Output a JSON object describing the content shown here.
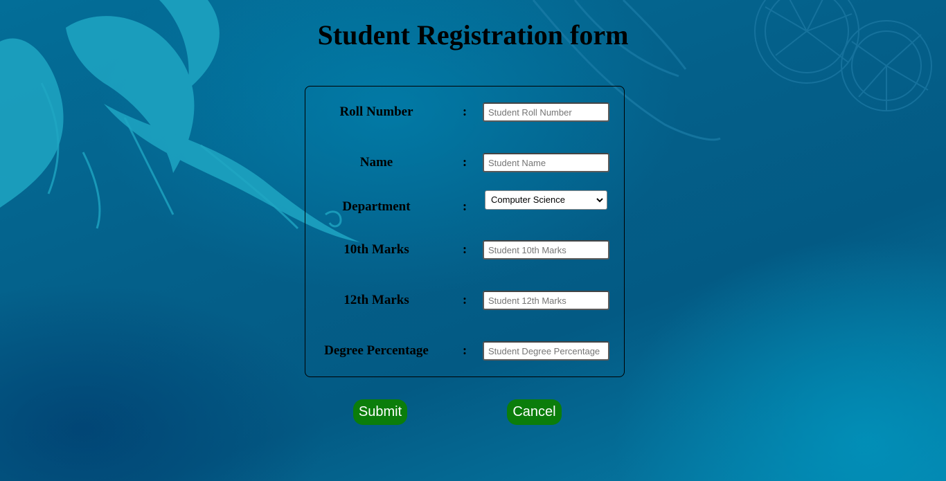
{
  "page": {
    "title": "Student Registration form"
  },
  "form": {
    "fields": [
      {
        "label": "Roll Number",
        "separator": ":",
        "type": "text",
        "value": "",
        "placeholder": "Student Roll Number"
      },
      {
        "label": "Name",
        "separator": ":",
        "type": "text",
        "value": "",
        "placeholder": "Student Name"
      },
      {
        "label": "Department",
        "separator": ":",
        "type": "select",
        "value": "Computer Science"
      },
      {
        "label": "10th Marks",
        "separator": ":",
        "type": "text",
        "value": "",
        "placeholder": "Student 10th Marks"
      },
      {
        "label": "12th Marks",
        "separator": ":",
        "type": "text",
        "value": "",
        "placeholder": "Student 12th Marks"
      },
      {
        "label": "Degree Percentage",
        "separator": ":",
        "type": "text",
        "value": "",
        "placeholder": "Student Degree Percentage"
      }
    ]
  },
  "buttons": {
    "submit_label": "Submit",
    "cancel_label": "Cancel"
  },
  "colors": {
    "button_bg": "#0b7d0b",
    "button_text": "#ffffff",
    "background_primary": "#04608a",
    "background_accent": "#2aa8c4"
  },
  "icons": {
    "select_arrow": "chevron-down-icon"
  }
}
